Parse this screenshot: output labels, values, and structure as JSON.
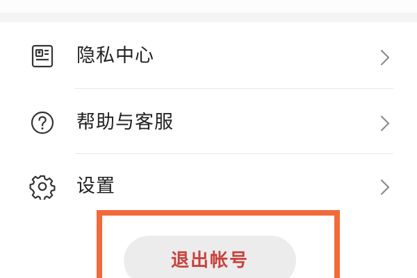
{
  "menu": {
    "items": [
      {
        "label": "隐私中心",
        "icon": "id-card-icon"
      },
      {
        "label": "帮助与客服",
        "icon": "help-circle-icon"
      },
      {
        "label": "设置",
        "icon": "gear-icon"
      }
    ]
  },
  "logout": {
    "label": "退出帐号",
    "text_color": "#c8413c"
  },
  "colors": {
    "highlight": "#f26a3a",
    "divider": "#e6e6e6",
    "icon": "#333333"
  }
}
